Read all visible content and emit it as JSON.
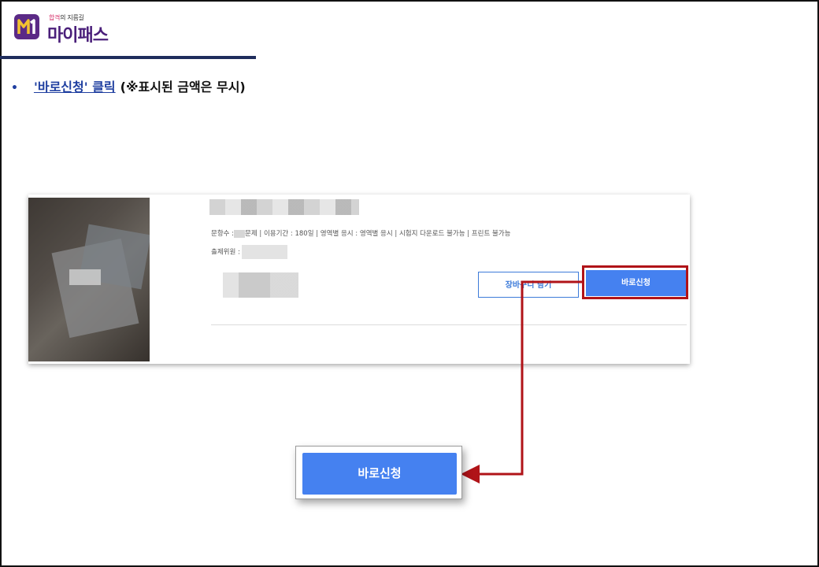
{
  "logo": {
    "tag_highlight": "합격",
    "tag_rest": "의 지름길",
    "name": "마이패스",
    "brand_color": "#4a1f7a"
  },
  "instruction": {
    "bullet": "•",
    "link_text": "'바로신청' 클릭",
    "note": "(※표시된 금액은 무시)"
  },
  "product": {
    "meta_label_questions": "문항수 :",
    "meta_unit_questions": "문제",
    "meta_rest": " | 이용기간 : 180일 | 영역별 응시 : 영역별 응시 | 시험지 다운로드 불가능 | 프린트 불가능",
    "meta_author_label": "출제위원 :",
    "cart_button": "장바구니 담기",
    "buy_button": "바로신청"
  },
  "callout": {
    "buy_button": "바로신청"
  },
  "colors": {
    "accent_blue": "#4581f0",
    "highlight_red": "#b01318",
    "nav_rule": "#1f2d5c"
  }
}
